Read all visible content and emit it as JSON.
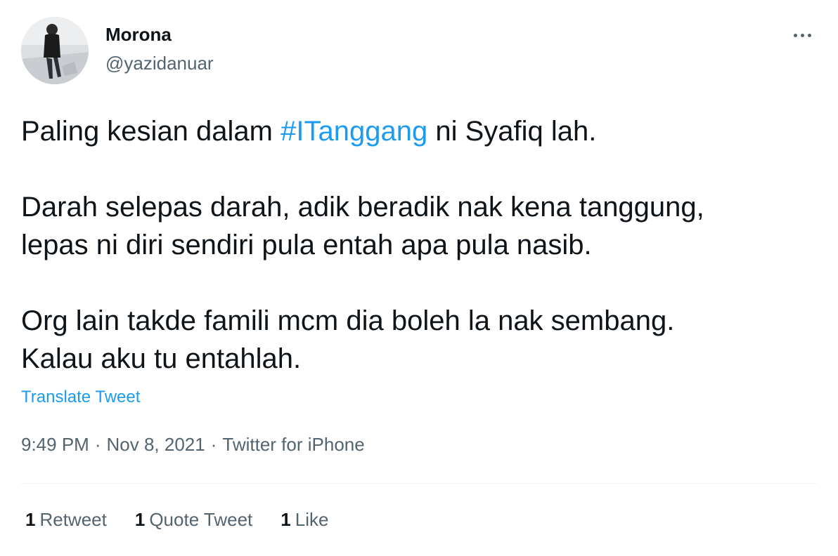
{
  "author": {
    "display_name": "Morona",
    "handle": "@yazidanuar"
  },
  "tweet": {
    "line1_before": "Paling kesian dalam ",
    "hashtag": "#ITanggang",
    "line1_after": " ni Syafiq lah.",
    "line2": "Darah selepas darah, adik beradik nak kena tanggung,",
    "line3": "lepas ni diri sendiri pula entah apa pula nasib.",
    "line4": "Org lain takde famili mcm dia boleh la nak sembang.",
    "line5": "Kalau aku tu entahlah."
  },
  "translate_label": "Translate Tweet",
  "meta": {
    "time": "9:49 PM",
    "separator": "·",
    "date": "Nov 8, 2021",
    "source": "Twitter for iPhone"
  },
  "stats": [
    {
      "count": "1",
      "label": "Retweet"
    },
    {
      "count": "1",
      "label": "Quote Tweet"
    },
    {
      "count": "1",
      "label": "Like"
    }
  ],
  "icons": {
    "more": "more-horizontal-icon"
  },
  "colors": {
    "link": "#1d9bf0",
    "text_primary": "#0f1419",
    "text_secondary": "#536471",
    "divider": "#eff3f4"
  }
}
